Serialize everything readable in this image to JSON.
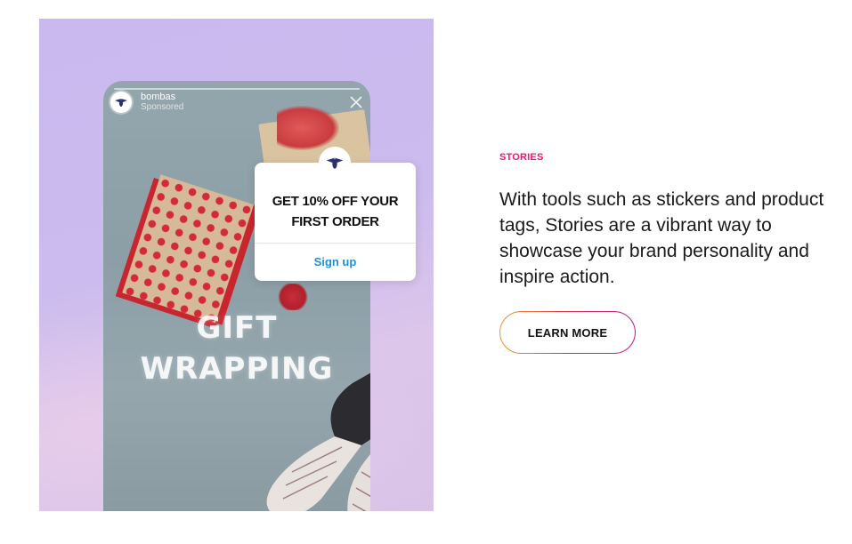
{
  "story": {
    "username": "bombas",
    "sponsored_label": "Sponsored",
    "headline_line1": "GIFT",
    "headline_line2": "WRAPPING",
    "sticker": {
      "text": "GET 10% OFF YOUR FIRST ORDER",
      "action_label": "Sign up"
    }
  },
  "section": {
    "eyebrow": "STORIES",
    "body": "With tools such as stickers and product tags, Stories are a vibrant way to showcase your brand personality and inspire action.",
    "cta_label": "LEARN MORE"
  },
  "colors": {
    "accent": "#e8196e",
    "link_blue": "#1f8fd6",
    "media_background": "#c9b9ef",
    "brand_navy": "#2a2f6e"
  },
  "icons": {
    "brand": "bee-logo-icon",
    "close": "close-icon"
  }
}
